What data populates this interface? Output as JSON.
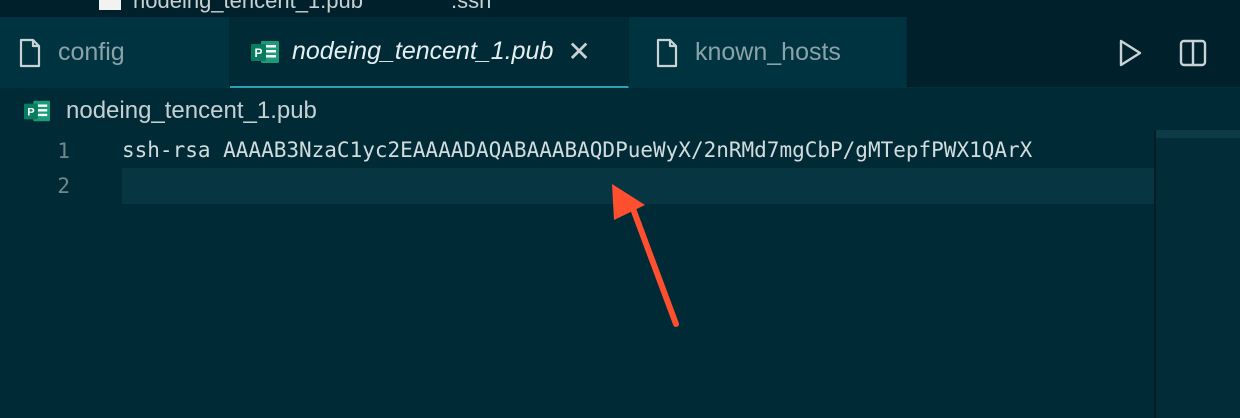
{
  "titlebar": {
    "file_name": "nodeing_tencent_1.pub",
    "dir_name": ".ssh"
  },
  "tabs": [
    {
      "label": "config",
      "icon": "file-icon",
      "active": false
    },
    {
      "label": "nodeing_tencent_1.pub",
      "icon": "publisher-icon",
      "active": true,
      "close": "✕"
    },
    {
      "label": "known_hosts",
      "icon": "file-icon",
      "active": false
    }
  ],
  "tab_actions": [
    {
      "name": "run-button",
      "icon": "play-icon"
    },
    {
      "name": "split-editor-button",
      "icon": "split-editor-icon"
    }
  ],
  "breadcrumb": {
    "label": "nodeing_tencent_1.pub",
    "icon": "publisher-icon"
  },
  "editor": {
    "lines": [
      {
        "number": "1",
        "text": "ssh-rsa AAAAB3NzaC1yc2EAAAADAQABAAABAQDPueWyX/2nRMd7mgCbP/gMTepfPWX1QArX"
      },
      {
        "number": "2",
        "text": ""
      }
    ]
  },
  "colors": {
    "background": "#002b36",
    "tabbar": "#00212b",
    "active_tab_accent": "#2aa1b3",
    "annotation_arrow": "#ff4f2f",
    "publisher_icon": "#087c5e"
  }
}
